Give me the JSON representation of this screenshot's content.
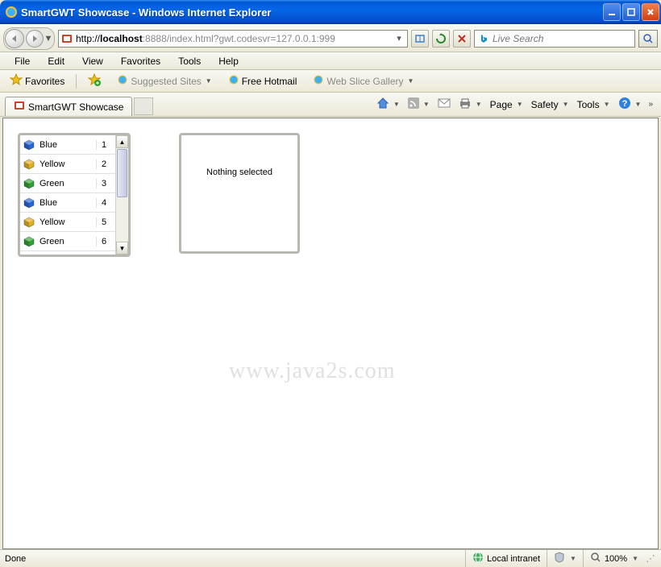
{
  "window": {
    "title": "SmartGWT Showcase - Windows Internet Explorer"
  },
  "addressbar": {
    "url_prefix": "http://",
    "url_host": "localhost",
    "url_rest": ":8888/index.html?gwt.codesvr=127.0.0.1:999",
    "search_placeholder": "Live Search"
  },
  "menu": {
    "items": [
      "File",
      "Edit",
      "View",
      "Favorites",
      "Tools",
      "Help"
    ]
  },
  "favbar": {
    "favorites": "Favorites",
    "suggested": "Suggested Sites",
    "hotmail": "Free Hotmail",
    "webslice": "Web Slice Gallery"
  },
  "tab": {
    "title": "SmartGWT Showcase"
  },
  "cmdbar": {
    "page": "Page",
    "safety": "Safety",
    "tools": "Tools"
  },
  "list": {
    "rows": [
      {
        "color": "blue",
        "name": "Blue",
        "num": "1"
      },
      {
        "color": "yellow",
        "name": "Yellow",
        "num": "2"
      },
      {
        "color": "green",
        "name": "Green",
        "num": "3"
      },
      {
        "color": "blue",
        "name": "Blue",
        "num": "4"
      },
      {
        "color": "yellow",
        "name": "Yellow",
        "num": "5"
      },
      {
        "color": "green",
        "name": "Green",
        "num": "6"
      }
    ]
  },
  "detail": {
    "message": "Nothing selected"
  },
  "watermark": "www.java2s.com",
  "status": {
    "done": "Done",
    "zone": "Local intranet",
    "zoom": "100%"
  },
  "colors": {
    "blue": "#2568d8",
    "yellow": "#e0b020",
    "green": "#30a030"
  }
}
